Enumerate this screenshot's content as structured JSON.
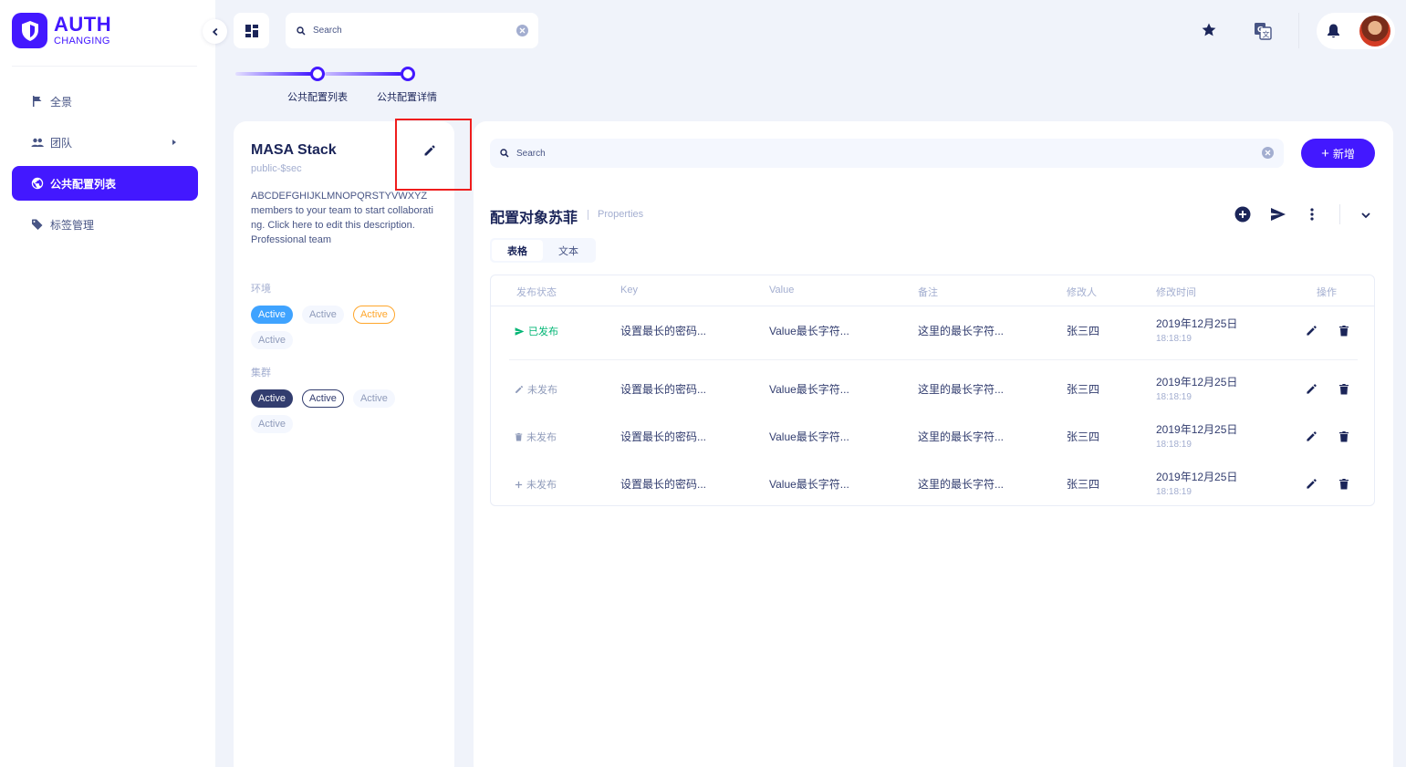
{
  "app": {
    "title": "AUTH",
    "subtitle": "CHANGING"
  },
  "sidebar": {
    "items": [
      {
        "label": "全景",
        "icon": "flag-icon"
      },
      {
        "label": "团队",
        "icon": "people-icon"
      },
      {
        "label": "公共配置列表",
        "icon": "globe-icon",
        "active": true
      },
      {
        "label": "标签管理",
        "icon": "tag-icon"
      }
    ]
  },
  "topbar": {
    "search_placeholder": "Search"
  },
  "stepper": {
    "steps": [
      "公共配置列表",
      "公共配置详情"
    ]
  },
  "project": {
    "title": "MASA Stack",
    "subtitle": "public-$sec",
    "description": "ABCDEFGHIJKLMNOPQRSTYVWXYZ members to your team to start collaborating. Click here to edit this description.",
    "team": "Professional team",
    "env_label": "环境",
    "env_chips": [
      "Active",
      "Active",
      "Active",
      "Active"
    ],
    "cluster_label": "集群",
    "cluster_chips": [
      "Active",
      "Active",
      "Active",
      "Active"
    ]
  },
  "main": {
    "search_placeholder": "Search",
    "add_label": "新增",
    "title": "配置对象苏菲",
    "subtitle": "Properties",
    "tabs": [
      "表格",
      "文本"
    ],
    "columns": [
      "发布状态",
      "Key",
      "Value",
      "备注",
      "修改人",
      "修改时间",
      "操作"
    ],
    "rows": [
      {
        "status": "已发布",
        "status_icon": "send-icon",
        "key": "设置最长的密码...",
        "value": "Value最长字符...",
        "note": "这里的最长字符...",
        "user": "张三四",
        "date": "2019年12月25日",
        "time": "18:18:19"
      },
      {
        "status": "未发布",
        "status_icon": "pencil-icon",
        "key": "设置最长的密码...",
        "value": "Value最长字符...",
        "note": "这里的最长字符...",
        "user": "张三四",
        "date": "2019年12月25日",
        "time": "18:18:19"
      },
      {
        "status": "未发布",
        "status_icon": "trash-icon",
        "key": "设置最长的密码...",
        "value": "Value最长字符...",
        "note": "这里的最长字符...",
        "user": "张三四",
        "date": "2019年12月25日",
        "time": "18:18:19"
      },
      {
        "status": "未发布",
        "status_icon": "plus-icon",
        "key": "设置最长的密码...",
        "value": "Value最长字符...",
        "note": "这里的最长字符...",
        "user": "张三四",
        "date": "2019年12月25日",
        "time": "18:18:19"
      }
    ]
  },
  "colors": {
    "primary": "#4318ff",
    "published": "#01b574",
    "chip_blue": "#3fa3ff",
    "chip_orange": "#ffa62b",
    "chip_dark": "#323d6f",
    "highlight": "#ef1d1d"
  }
}
